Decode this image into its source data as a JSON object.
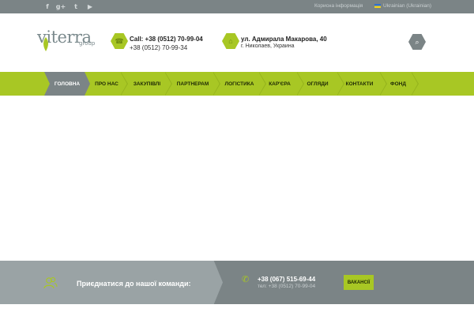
{
  "topbar": {
    "social": [
      {
        "icon": "facebook-icon",
        "glyph": "f"
      },
      {
        "icon": "google-plus-icon",
        "glyph": "g+"
      },
      {
        "icon": "twitter-icon",
        "glyph": "t"
      },
      {
        "icon": "youtube-icon",
        "glyph": "▶"
      }
    ],
    "useful_info": "Корисна інформація",
    "language": "Ukrainian (Ukrainian)"
  },
  "header": {
    "logo_main": "viterra",
    "logo_sub": "group",
    "phone_primary": "Call: +38 (0512) 70-99-04",
    "phone_secondary": "+38 (0512) 70-99-34",
    "address_street": "ул. Адмирала Макарова, 40",
    "address_city": "г. Николаев, Украина"
  },
  "nav": {
    "items": [
      "Головна",
      "Про нас",
      "Закупівлі",
      "Партнерам",
      "Логістика",
      "Кар'єра",
      "Огляди",
      "Контакти",
      "Фонд"
    ],
    "active_index": 0
  },
  "footer_band": {
    "join_text": "Приєднатися до нашої команди:",
    "phone": "+38 (067) 515-69-44",
    "tel": "тел: +38 (0512) 70-99-04",
    "vacancies_button": "ВАКАНСІЇ"
  },
  "colors": {
    "brand_green": "#a8c724",
    "brand_grey": "#7b8486"
  }
}
